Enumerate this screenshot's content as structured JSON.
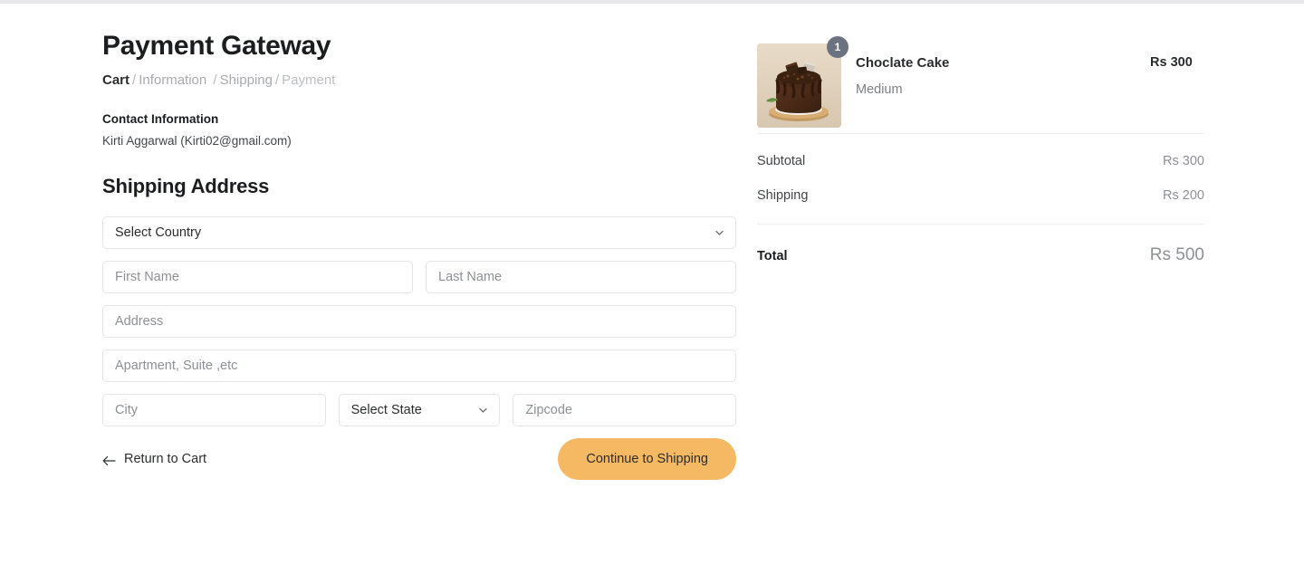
{
  "page": {
    "title": "Payment Gateway"
  },
  "breadcrumb": {
    "items": [
      {
        "label": "Cart",
        "state": "active"
      },
      {
        "label": "Information",
        "state": "normal"
      },
      {
        "label": "Shipping",
        "state": "normal"
      },
      {
        "label": "Payment",
        "state": "dim"
      }
    ],
    "separator": "/"
  },
  "contact": {
    "heading": "Contact Information",
    "value": "Kirti Aggarwal (Kirti02@gmail.com)"
  },
  "shipping_address": {
    "section_title": "Shipping Address",
    "fields": {
      "country": {
        "value": "Select Country",
        "icon": "chevron-down-icon"
      },
      "first_name": {
        "placeholder": "First Name",
        "value": ""
      },
      "last_name": {
        "placeholder": "Last Name",
        "value": ""
      },
      "address": {
        "placeholder": "Address",
        "value": ""
      },
      "apartment": {
        "placeholder": "Apartment, Suite ,etc",
        "value": ""
      },
      "city": {
        "placeholder": "City",
        "value": ""
      },
      "state": {
        "value": "Select State",
        "icon": "chevron-down-icon"
      },
      "zipcode": {
        "placeholder": "Zipcode",
        "value": ""
      }
    }
  },
  "actions": {
    "return_label": "Return to Cart",
    "return_icon": "arrow-left-icon",
    "continue_label": "Continue to Shipping",
    "continue_color": "#f6b963"
  },
  "order_summary": {
    "item": {
      "name": "Choclate Cake",
      "variant": "Medium",
      "price": "Rs 300",
      "quantity": "1",
      "image_alt": "chocolate-cake-thumbnail"
    },
    "totals": [
      {
        "label": "Subtotal",
        "value": "Rs 300"
      },
      {
        "label": "Shipping",
        "value": "Rs 200"
      }
    ],
    "grand_total": {
      "label": "Total",
      "value": "Rs 500"
    }
  }
}
